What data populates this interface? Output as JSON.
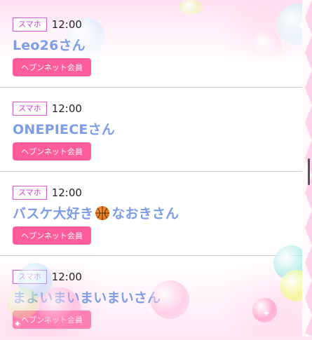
{
  "entries": [
    {
      "device": "スマホ",
      "time": "12:00",
      "name": "Leo26さん",
      "member_label": "ヘブンネット会員"
    },
    {
      "device": "スマホ",
      "time": "12:00",
      "name": "ONEPIECEさん",
      "member_label": "ヘブンネット会員"
    },
    {
      "device": "スマホ",
      "time": "12:00",
      "name_prefix": "バスケ大好き",
      "name_icon": "basketball-icon",
      "name_suffix": "なおきさん",
      "member_label": "ヘブンネット会員"
    },
    {
      "device": "スマホ",
      "time": "12:00",
      "name": "まよいまいまいまいさん",
      "member_label": "ヘブンネット会員"
    }
  ],
  "colors": {
    "device_tag_border": "#d35bd6",
    "name_text": "#7d9de8",
    "member_button": "#ff5c9c",
    "divider": "#c9c9c9"
  }
}
